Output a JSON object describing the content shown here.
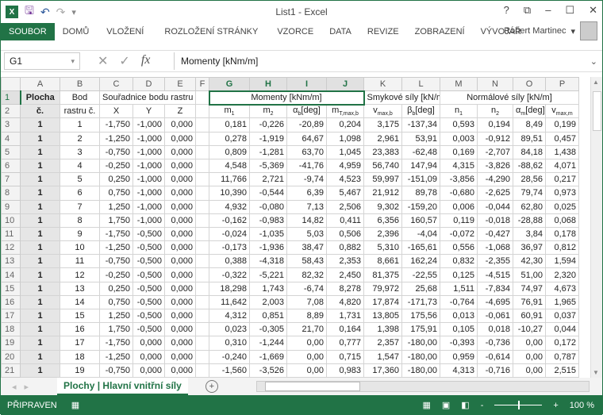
{
  "window": {
    "title": "List1 - Excel",
    "help": "?",
    "minimize": "–",
    "maximize": "☐",
    "close": "✕",
    "restore": "⧉"
  },
  "quick_access": {
    "app_icon": "X",
    "save": "🖫",
    "undo": "↶",
    "redo": "↷",
    "customize": "▾"
  },
  "ribbon": {
    "tabs": [
      "SOUBOR",
      "DOMŮ",
      "VLOŽENÍ",
      "ROZLOŽENÍ STRÁNKY",
      "VZORCE",
      "DATA",
      "REVIZE",
      "ZOBRAZENÍ",
      "VÝVOJÁŘ"
    ],
    "user": "Robert Martinec"
  },
  "formula_bar": {
    "name_box": "G1",
    "cancel": "✕",
    "enter": "✓",
    "fx": "fx",
    "value": "Momenty [kNm/m]"
  },
  "columns": [
    "A",
    "B",
    "C",
    "D",
    "E",
    "F",
    "G",
    "H",
    "I",
    "J",
    "K",
    "L",
    "M",
    "N",
    "O",
    "P"
  ],
  "header_row1": {
    "A": "Plocha",
    "B": "Bod",
    "C": "Souřadnice bodu rastru [m]",
    "G": "Momenty [kNm/m]",
    "K": "Smykové síly [kN/m]",
    "M": "Normálové síly [kN/m]"
  },
  "header_row2": [
    [
      "č.",
      ""
    ],
    [
      "rastru č.",
      ""
    ],
    [
      "X",
      ""
    ],
    [
      "Y",
      ""
    ],
    [
      "Z",
      ""
    ],
    [
      "",
      ""
    ],
    [
      "m",
      "1"
    ],
    [
      "m",
      "2"
    ],
    [
      "α",
      "b",
      "[deg]"
    ],
    [
      "m",
      "T,max,b"
    ],
    [
      "v",
      "max,b"
    ],
    [
      "β",
      "b",
      "[deg]"
    ],
    [
      "n",
      "1"
    ],
    [
      "n",
      "2"
    ],
    [
      "α",
      "m",
      "[deg]"
    ],
    [
      "v",
      "max,m"
    ]
  ],
  "rows": [
    [
      1,
      1,
      "-1,750",
      "-1,000",
      "0,000",
      "",
      "0,181",
      "-0,226",
      "-20,89",
      "0,204",
      "3,175",
      "-137,34",
      "0,593",
      "0,194",
      "8,49",
      "0,199"
    ],
    [
      1,
      2,
      "-1,250",
      "-1,000",
      "0,000",
      "",
      "0,278",
      "-1,919",
      "64,67",
      "1,098",
      "2,961",
      "53,91",
      "0,003",
      "-0,912",
      "89,51",
      "0,457"
    ],
    [
      1,
      3,
      "-0,750",
      "-1,000",
      "0,000",
      "",
      "0,809",
      "-1,281",
      "63,70",
      "1,045",
      "23,383",
      "-62,48",
      "0,169",
      "-2,707",
      "84,18",
      "1,438"
    ],
    [
      1,
      4,
      "-0,250",
      "-1,000",
      "0,000",
      "",
      "4,548",
      "-5,369",
      "-41,76",
      "4,959",
      "56,740",
      "147,94",
      "4,315",
      "-3,826",
      "-88,62",
      "4,071"
    ],
    [
      1,
      5,
      "0,250",
      "-1,000",
      "0,000",
      "",
      "11,766",
      "2,721",
      "-9,74",
      "4,523",
      "59,997",
      "-151,09",
      "-3,856",
      "-4,290",
      "28,56",
      "0,217"
    ],
    [
      1,
      6,
      "0,750",
      "-1,000",
      "0,000",
      "",
      "10,390",
      "-0,544",
      "6,39",
      "5,467",
      "21,912",
      "89,78",
      "-0,680",
      "-2,625",
      "79,74",
      "0,973"
    ],
    [
      1,
      7,
      "1,250",
      "-1,000",
      "0,000",
      "",
      "4,932",
      "-0,080",
      "7,13",
      "2,506",
      "9,302",
      "-159,20",
      "0,006",
      "-0,044",
      "62,80",
      "0,025"
    ],
    [
      1,
      8,
      "1,750",
      "-1,000",
      "0,000",
      "",
      "-0,162",
      "-0,983",
      "14,82",
      "0,411",
      "6,356",
      "160,57",
      "0,119",
      "-0,018",
      "-28,88",
      "0,068"
    ],
    [
      1,
      9,
      "-1,750",
      "-0,500",
      "0,000",
      "",
      "-0,024",
      "-1,035",
      "5,03",
      "0,506",
      "2,396",
      "-4,04",
      "-0,072",
      "-0,427",
      "3,84",
      "0,178"
    ],
    [
      1,
      10,
      "-1,250",
      "-0,500",
      "0,000",
      "",
      "-0,173",
      "-1,936",
      "38,47",
      "0,882",
      "5,310",
      "-165,61",
      "0,556",
      "-1,068",
      "36,97",
      "0,812"
    ],
    [
      1,
      11,
      "-0,750",
      "-0,500",
      "0,000",
      "",
      "0,388",
      "-4,318",
      "58,43",
      "2,353",
      "8,661",
      "162,24",
      "0,832",
      "-2,355",
      "42,30",
      "1,594"
    ],
    [
      1,
      12,
      "-0,250",
      "-0,500",
      "0,000",
      "",
      "-0,322",
      "-5,221",
      "82,32",
      "2,450",
      "81,375",
      "-22,55",
      "0,125",
      "-4,515",
      "51,00",
      "2,320"
    ],
    [
      1,
      13,
      "0,250",
      "-0,500",
      "0,000",
      "",
      "18,298",
      "1,743",
      "-6,74",
      "8,278",
      "79,972",
      "25,68",
      "1,511",
      "-7,834",
      "74,97",
      "4,673"
    ],
    [
      1,
      14,
      "0,750",
      "-0,500",
      "0,000",
      "",
      "11,642",
      "2,003",
      "7,08",
      "4,820",
      "17,874",
      "-171,73",
      "-0,764",
      "-4,695",
      "76,91",
      "1,965"
    ],
    [
      1,
      15,
      "1,250",
      "-0,500",
      "0,000",
      "",
      "4,312",
      "0,851",
      "8,89",
      "1,731",
      "13,805",
      "175,56",
      "0,013",
      "-0,061",
      "60,91",
      "0,037"
    ],
    [
      1,
      16,
      "1,750",
      "-0,500",
      "0,000",
      "",
      "0,023",
      "-0,305",
      "21,70",
      "0,164",
      "1,398",
      "175,91",
      "0,105",
      "0,018",
      "-10,27",
      "0,044"
    ],
    [
      1,
      17,
      "-1,750",
      "0,000",
      "0,000",
      "",
      "0,310",
      "-1,244",
      "0,00",
      "0,777",
      "2,357",
      "-180,00",
      "-0,393",
      "-0,736",
      "0,00",
      "0,172"
    ],
    [
      1,
      18,
      "-1,250",
      "0,000",
      "0,000",
      "",
      "-0,240",
      "-1,669",
      "0,00",
      "0,715",
      "1,547",
      "-180,00",
      "0,959",
      "-0,614",
      "0,00",
      "0,787"
    ],
    [
      1,
      19,
      "-0,750",
      "0,000",
      "0,000",
      "",
      "-1,560",
      "-3,526",
      "0,00",
      "0,983",
      "17,360",
      "-180,00",
      "4,313",
      "-0,716",
      "0,00",
      "2,515"
    ]
  ],
  "sheet_tabs": {
    "active": "Plochy | Hlavní vnitřní síly",
    "add": "+"
  },
  "status": {
    "ready": "PŘIPRAVEN",
    "zoom": "100 %",
    "zoom_minus": "-",
    "zoom_plus": "+",
    "zoom_fraction": 0.5
  },
  "colors": {
    "accent": "#217346"
  }
}
